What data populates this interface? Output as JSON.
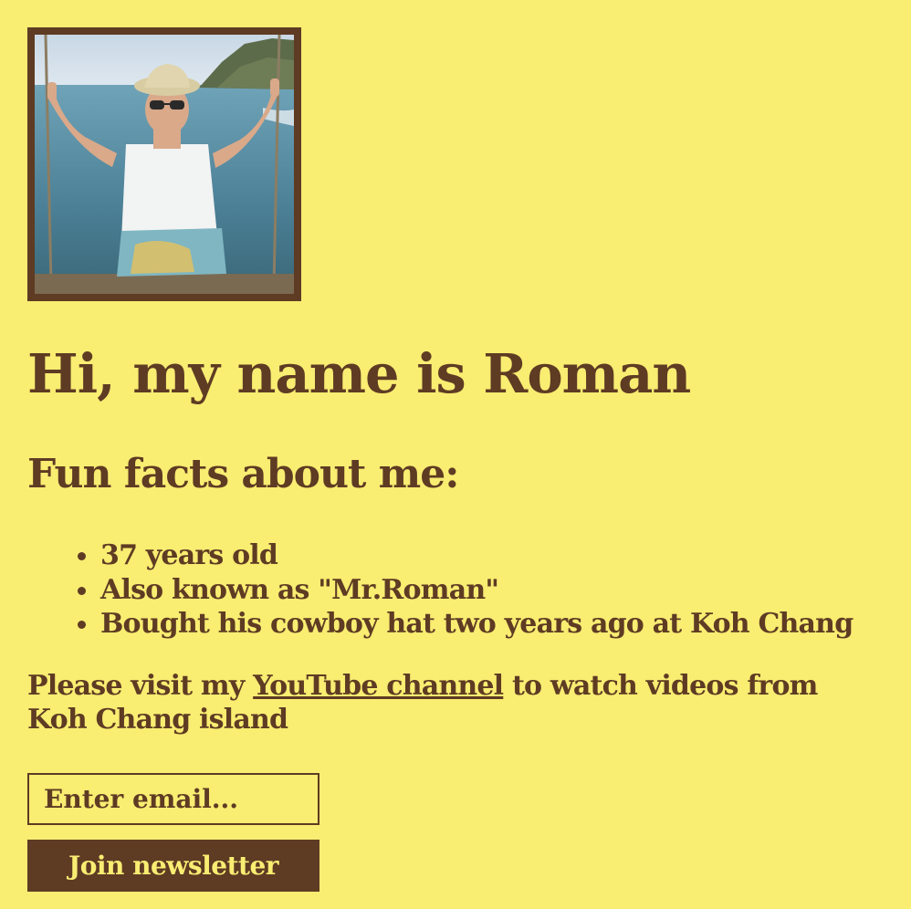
{
  "profile": {
    "photo_subject": "man-on-rope-swing-photo",
    "heading": "Hi, my name is Roman",
    "facts_heading": "Fun facts about me:",
    "facts": [
      "37 years old",
      "Also known as \"Mr.Roman\"",
      "Bought his cowboy hat two years ago at Koh Chang"
    ],
    "visit_prefix": "Please visit my ",
    "visit_link": "YouTube channel",
    "visit_suffix": " to watch videos from Koh Chang island"
  },
  "newsletter": {
    "email_placeholder": "Enter email...",
    "join_label": "Join newsletter"
  },
  "colors": {
    "background": "#f9ed72",
    "brown": "#5e3b23"
  }
}
